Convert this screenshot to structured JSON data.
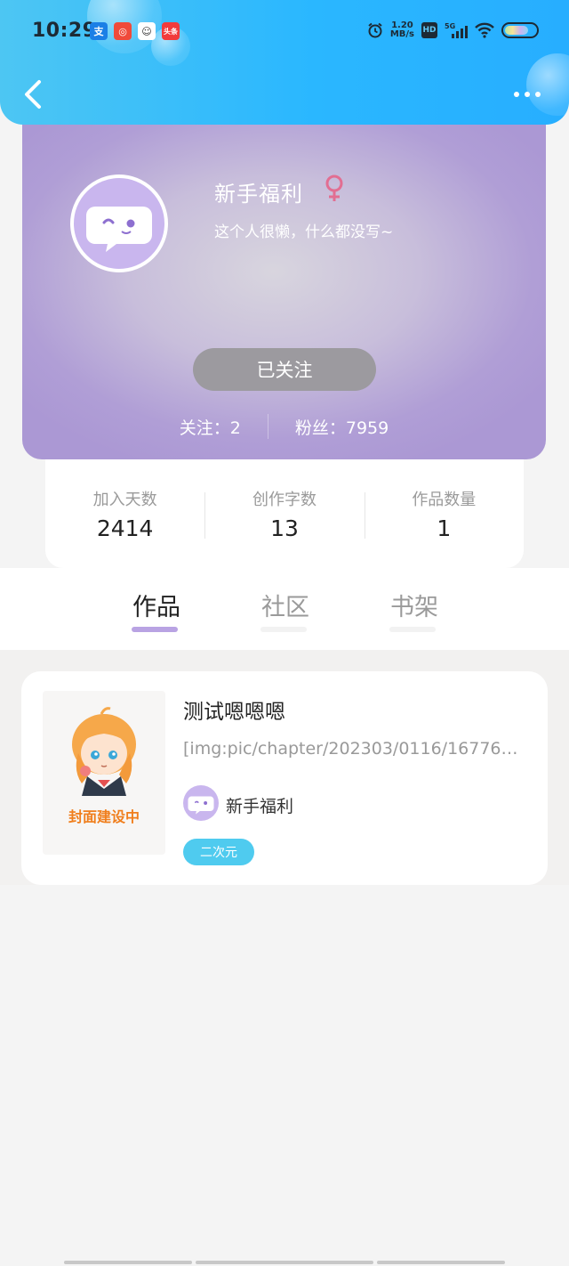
{
  "status_bar": {
    "time": "10:29",
    "net_speed_top": "1.20",
    "net_speed_bottom": "MB/s",
    "hd": "HD",
    "five_g": "5G",
    "battery_level": 0.75
  },
  "header": {
    "back_icon": "chevron-left-icon",
    "more_icon": "more-dots-icon"
  },
  "profile": {
    "nickname": "新手福利",
    "gender_icon": "female-icon",
    "signature": "这个人很懒，什么都没写~",
    "follow_button": "已关注",
    "following": "关注：2",
    "fans": "粉丝：7959"
  },
  "stats": [
    {
      "label": "加入天数",
      "value": "2414"
    },
    {
      "label": "创作字数",
      "value": "13"
    },
    {
      "label": "作品数量",
      "value": "1"
    }
  ],
  "tabs": [
    {
      "label": "作品",
      "active": true
    },
    {
      "label": "社区",
      "active": false
    },
    {
      "label": "书架",
      "active": false
    }
  ],
  "works": [
    {
      "title": "测试嗯嗯嗯",
      "description": "[img:pic/chapter/202303/0116/16776…",
      "cover_caption": "封面建设中",
      "author": "新手福利",
      "tag": "二次元"
    }
  ],
  "colors": {
    "header_blue": "#2ab7ff",
    "profile_purple": "#b09ed6",
    "tag_cyan": "#4fcbef",
    "tab_underline": "#b9a3e3",
    "cover_orange": "#f07e1c"
  }
}
